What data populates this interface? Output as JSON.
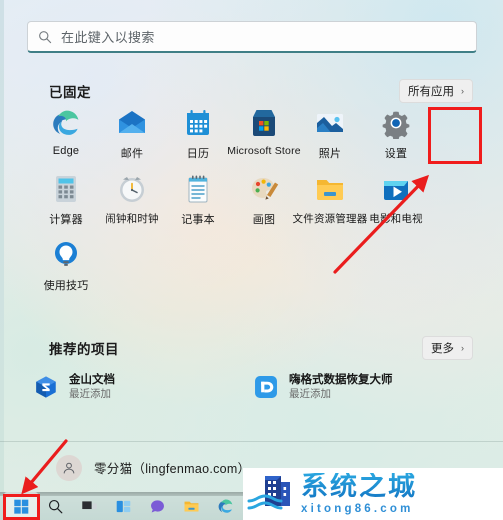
{
  "search": {
    "placeholder": "在此键入以搜索",
    "icon": "search-icon"
  },
  "pinned": {
    "title": "已固定",
    "all_apps_label": "所有应用",
    "chevron": "›",
    "items": [
      {
        "label": "Edge",
        "icon": "edge-icon"
      },
      {
        "label": "邮件",
        "icon": "mail-icon"
      },
      {
        "label": "日历",
        "icon": "calendar-icon"
      },
      {
        "label": "Microsoft Store",
        "icon": "microsoft-store-icon"
      },
      {
        "label": "照片",
        "icon": "photos-icon"
      },
      {
        "label": "设置",
        "icon": "settings-gear-icon"
      },
      {
        "label": "计算器",
        "icon": "calculator-icon"
      },
      {
        "label": "闹钟和时钟",
        "icon": "clock-icon"
      },
      {
        "label": "记事本",
        "icon": "notepad-icon"
      },
      {
        "label": "画图",
        "icon": "paint-icon"
      },
      {
        "label": "文件资源管理器",
        "icon": "file-explorer-icon"
      },
      {
        "label": "电影和电视",
        "icon": "movies-tv-icon"
      },
      {
        "label": "使用技巧",
        "icon": "tips-lightbulb-icon"
      }
    ]
  },
  "recommended": {
    "title": "推荐的项目",
    "more_label": "更多",
    "chevron": "›",
    "items": [
      {
        "name": "金山文档",
        "subtitle": "最近添加",
        "icon": "wps-docs-icon"
      },
      {
        "name": "嗨格式数据恢复大师",
        "subtitle": "最近添加",
        "icon": "data-recovery-icon"
      }
    ]
  },
  "account": {
    "name": "零分猫（lingfenmao.com）",
    "icon": "user-avatar-icon"
  },
  "taskbar": {
    "items": [
      {
        "name": "start-button",
        "icon": "windows-logo-icon"
      },
      {
        "name": "search-button",
        "icon": "search-icon"
      },
      {
        "name": "task-view-button",
        "icon": "task-view-icon"
      },
      {
        "name": "widgets-button",
        "icon": "widgets-icon"
      },
      {
        "name": "chat-button",
        "icon": "chat-icon"
      },
      {
        "name": "file-explorer-button",
        "icon": "folder-icon"
      },
      {
        "name": "edge-button",
        "icon": "edge-icon"
      }
    ]
  },
  "watermark": {
    "chinese": "系统之城",
    "english": "xitong86.com"
  },
  "annotations": {
    "highlight_color": "#f01c1c",
    "arrow_color": "#ea1d1d",
    "settings_highlight_target": "设置",
    "start_highlight_target": "start-button"
  }
}
